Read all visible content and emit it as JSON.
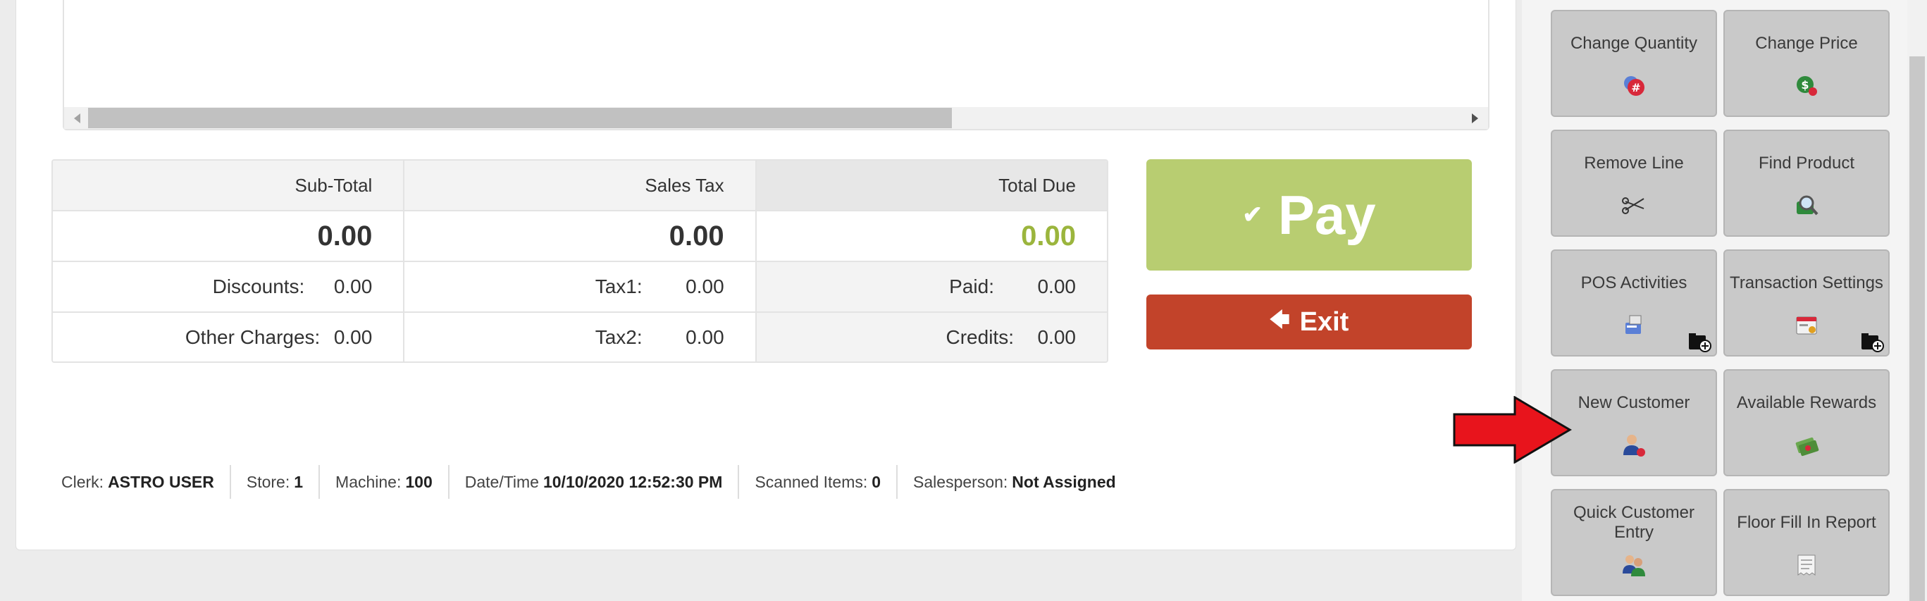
{
  "totals": {
    "subtotal": {
      "label": "Sub-Total",
      "value": "0.00"
    },
    "sales_tax": {
      "label": "Sales Tax",
      "value": "0.00"
    },
    "total_due": {
      "label": "Total Due",
      "value": "0.00"
    },
    "discounts": {
      "label": "Discounts:",
      "value": "0.00"
    },
    "other_charges": {
      "label": "Other Charges:",
      "value": "0.00"
    },
    "tax1": {
      "label": "Tax1:",
      "value": "0.00"
    },
    "tax2": {
      "label": "Tax2:",
      "value": "0.00"
    },
    "paid": {
      "label": "Paid:",
      "value": "0.00"
    },
    "credits": {
      "label": "Credits:",
      "value": "0.00"
    }
  },
  "actions": {
    "pay_label": "Pay",
    "exit_label": "Exit"
  },
  "status": {
    "clerk_label": "Clerk:",
    "clerk_value": "ASTRO USER",
    "store_label": "Store:",
    "store_value": "1",
    "machine_label": "Machine:",
    "machine_value": "100",
    "datetime_label": "Date/Time",
    "datetime_value": "10/10/2020 12:52:30 PM",
    "scanned_label": "Scanned Items:",
    "scanned_value": "0",
    "salesperson_label": "Salesperson:",
    "salesperson_value": "Not Assigned"
  },
  "tiles": [
    {
      "label": "Change Quantity",
      "icon": "quantity-hash-icon"
    },
    {
      "label": "Change Price",
      "icon": "price-tag-icon"
    },
    {
      "label": "Remove Line",
      "icon": "scissors-icon"
    },
    {
      "label": "Find Product",
      "icon": "magnifier-icon"
    },
    {
      "label": "POS Activities",
      "icon": "pos-activities-icon"
    },
    {
      "label": "Transaction Settings",
      "icon": "transaction-settings-icon"
    },
    {
      "label": "New Customer",
      "icon": "new-customer-icon"
    },
    {
      "label": "Available Rewards",
      "icon": "rewards-icon"
    },
    {
      "label": "Quick Customer Entry",
      "icon": "quick-customer-icon"
    },
    {
      "label": "Floor Fill In Report",
      "icon": "report-icon"
    }
  ],
  "colors": {
    "pay": "#b8cd71",
    "exit": "#c2432a",
    "total_due_value": "#9bb53d",
    "arrow": "#e8141c"
  }
}
